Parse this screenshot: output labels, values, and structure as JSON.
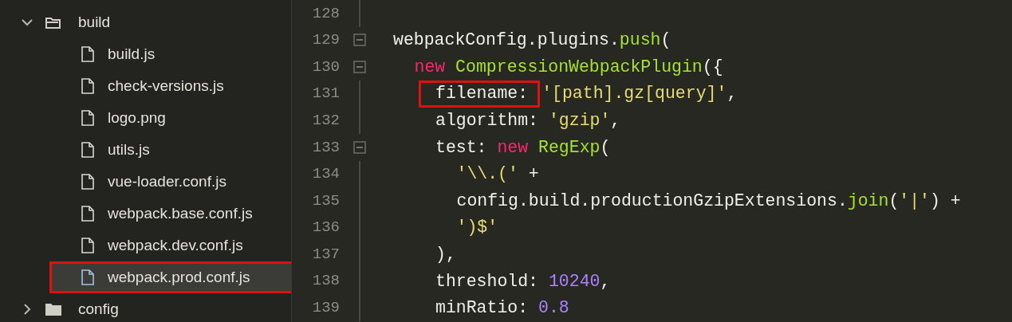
{
  "sidebar": {
    "tree": [
      {
        "name": "build",
        "kind": "folder",
        "expanded": true,
        "children": [
          {
            "name": "build.js",
            "kind": "file",
            "selected": false,
            "annotated": false
          },
          {
            "name": "check-versions.js",
            "kind": "file",
            "selected": false,
            "annotated": false
          },
          {
            "name": "logo.png",
            "kind": "file",
            "selected": false,
            "annotated": false
          },
          {
            "name": "utils.js",
            "kind": "file",
            "selected": false,
            "annotated": false
          },
          {
            "name": "vue-loader.conf.js",
            "kind": "file",
            "selected": false,
            "annotated": false
          },
          {
            "name": "webpack.base.conf.js",
            "kind": "file",
            "selected": false,
            "annotated": false
          },
          {
            "name": "webpack.dev.conf.js",
            "kind": "file",
            "selected": false,
            "annotated": false
          },
          {
            "name": "webpack.prod.conf.js",
            "kind": "file",
            "selected": true,
            "annotated": true
          }
        ]
      },
      {
        "name": "config",
        "kind": "folder",
        "expanded": false
      }
    ]
  },
  "editor": {
    "lines": [
      {
        "number": "128",
        "fold": false
      },
      {
        "number": "129",
        "fold": true,
        "tokens": [
          {
            "text": "webpackConfig.plugins.",
            "kind": "plain"
          },
          {
            "text": "push",
            "kind": "func"
          },
          {
            "text": "(",
            "kind": "plain"
          }
        ],
        "children": [
          {
            "number": "130",
            "fold": true,
            "tokens": [
              {
                "text": "new",
                "kind": "keyword"
              },
              {
                "text": " CompressionWebpackPlugin",
                "kind": "func"
              },
              {
                "text": "({",
                "kind": "plain"
              }
            ],
            "children": [
              {
                "number": "131",
                "fold": false,
                "tokens": [
                  {
                    "text": "filename:",
                    "kind": "plain",
                    "annotated": true
                  },
                  {
                    "text": "'[path].gz[query]'",
                    "kind": "string"
                  },
                  {
                    "text": ",",
                    "kind": "plain"
                  }
                ]
              },
              {
                "number": "132",
                "fold": false,
                "tokens": [
                  {
                    "text": "algorithm: ",
                    "kind": "plain"
                  },
                  {
                    "text": "'gzip'",
                    "kind": "string"
                  },
                  {
                    "text": ",",
                    "kind": "plain"
                  }
                ]
              },
              {
                "number": "133",
                "fold": true,
                "tokens": [
                  {
                    "text": "test: ",
                    "kind": "plain"
                  },
                  {
                    "text": "new",
                    "kind": "keyword"
                  },
                  {
                    "text": " RegExp",
                    "kind": "func"
                  },
                  {
                    "text": "(",
                    "kind": "plain"
                  }
                ],
                "children": [
                  {
                    "number": "134",
                    "fold": false,
                    "tokens": [
                      {
                        "text": "'\\\\.('",
                        "kind": "string"
                      },
                      {
                        "text": " +",
                        "kind": "plain"
                      }
                    ]
                  },
                  {
                    "number": "135",
                    "fold": false,
                    "tokens": [
                      {
                        "text": "config.build.productionGzipExtensions.",
                        "kind": "plain"
                      },
                      {
                        "text": "join",
                        "kind": "func"
                      },
                      {
                        "text": "(",
                        "kind": "plain"
                      },
                      {
                        "text": "'|'",
                        "kind": "string"
                      },
                      {
                        "text": ") +",
                        "kind": "plain"
                      }
                    ]
                  },
                  {
                    "number": "136",
                    "fold": false,
                    "tokens": [
                      {
                        "text": "')$'",
                        "kind": "string"
                      }
                    ]
                  }
                ]
              },
              {
                "number": "137",
                "fold": false,
                "tokens": [
                  {
                    "text": "),",
                    "kind": "plain"
                  }
                ]
              },
              {
                "number": "138",
                "fold": false,
                "tokens": [
                  {
                    "text": "threshold: ",
                    "kind": "plain"
                  },
                  {
                    "text": "10240",
                    "kind": "number"
                  },
                  {
                    "text": ",",
                    "kind": "plain"
                  }
                ]
              },
              {
                "number": "139",
                "fold": false,
                "tokens": [
                  {
                    "text": "minRatio: ",
                    "kind": "plain"
                  },
                  {
                    "text": "0.8",
                    "kind": "number"
                  }
                ]
              }
            ]
          }
        ]
      }
    ]
  }
}
